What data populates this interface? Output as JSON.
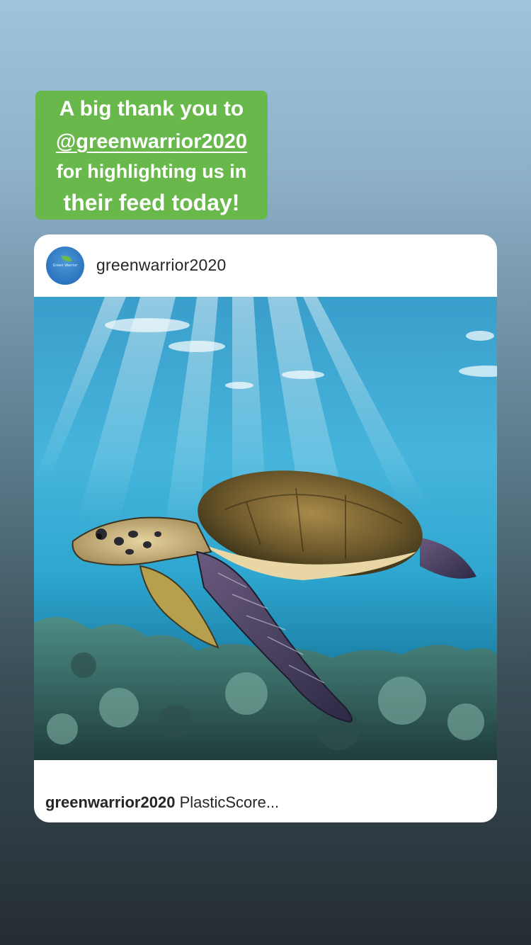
{
  "story": {
    "caption": {
      "line1": "A big thank you to",
      "line2": "@greenwarrior2020",
      "line3": "for highlighting us in",
      "line4": "their feed today!"
    }
  },
  "post": {
    "username": "greenwarrior2020",
    "avatar_text": "Green Warrior",
    "image_icon": "sea-turtle-photo",
    "footer": {
      "username": "greenwarrior2020",
      "caption": "PlasticScore..."
    }
  },
  "colors": {
    "caption_bg": "#68b84b",
    "caption_text": "#ffffff",
    "card_bg": "#ffffff",
    "text_dark": "#262626"
  }
}
